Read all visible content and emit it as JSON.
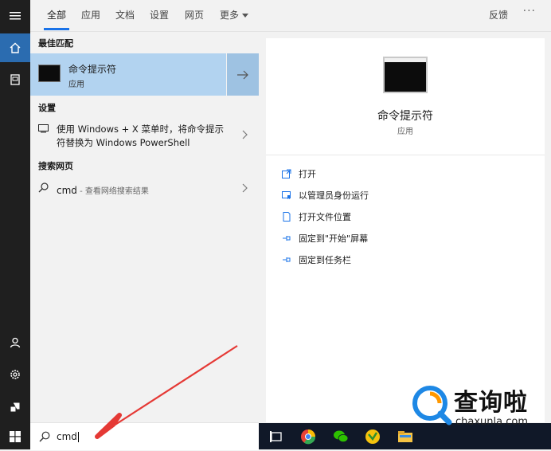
{
  "tabs": [
    "全部",
    "应用",
    "文档",
    "设置",
    "网页",
    "更多"
  ],
  "topbar": {
    "feedback": "反馈",
    "more_dots": "···"
  },
  "rail": {
    "items": [
      "menu-icon",
      "home-icon",
      "documents-icon",
      "user-icon",
      "settings-icon",
      "photos-icon",
      "windows-start-icon"
    ]
  },
  "results": {
    "best_match_header": "最佳匹配",
    "best_match": {
      "title": "命令提示符",
      "subtitle": "应用"
    },
    "settings_header": "设置",
    "setting_item": "使用 Windows + X 菜单时，将命令提示符替换为 Windows PowerShell",
    "web_header": "搜索网页",
    "web_item": {
      "query": "cmd",
      "suffix": " - 查看网络搜索结果"
    }
  },
  "details": {
    "title": "命令提示符",
    "subtitle": "应用",
    "actions": [
      "打开",
      "以管理员身份运行",
      "打开文件位置",
      "固定到\"开始\"屏幕",
      "固定到任务栏"
    ]
  },
  "search": {
    "value": "cmd"
  },
  "taskbar": {
    "icons": [
      "task-view-icon",
      "browser-icon",
      "wechat-icon",
      "app-icon",
      "file-explorer-icon"
    ]
  },
  "watermark": {
    "brand": "查询啦",
    "url": "chaxunla.com"
  },
  "colors": {
    "accent": "#1a73e8",
    "selection": "#b2d3f0",
    "rail": "#1f1f1f",
    "taskbar": "#101828",
    "arrow": "#e53935"
  }
}
